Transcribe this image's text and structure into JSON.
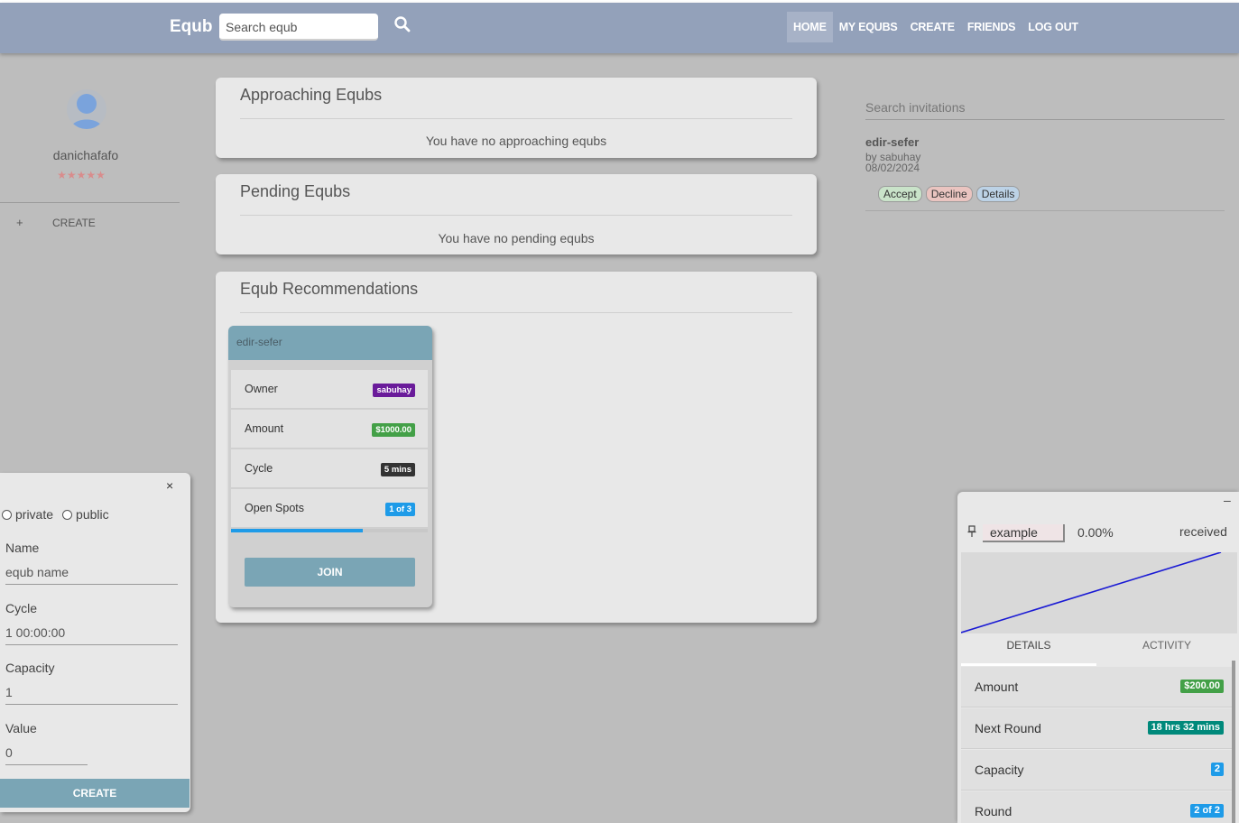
{
  "nav": {
    "brand": "Equb",
    "search_placeholder": "Search equb",
    "links": [
      "HOME",
      "MY EQUBS",
      "CREATE",
      "FRIENDS",
      "LOG OUT"
    ],
    "active": "HOME"
  },
  "sidebar": {
    "username": "danichafafo",
    "stars": "★★★★★",
    "create_label": "CREATE",
    "plus": "+"
  },
  "approaching": {
    "title": "Approaching Equbs",
    "empty": "You have no approaching equbs"
  },
  "pending": {
    "title": "Pending Equbs",
    "empty": "You have no pending equbs"
  },
  "recommendations": {
    "title": "Equb Recommendations",
    "card": {
      "name": "edir-sefer",
      "rows": [
        {
          "label": "Owner",
          "value": "sabuhay",
          "color": "#6a1b9a"
        },
        {
          "label": "Amount",
          "value": "$1000.00",
          "color": "#43a047"
        },
        {
          "label": "Cycle",
          "value": "5 mins",
          "color": "#333333"
        },
        {
          "label": "Open Spots",
          "value": "1 of 3",
          "color": "#1e9be8"
        }
      ],
      "progress_fraction": 0.67,
      "join_label": "JOIN"
    }
  },
  "invitations": {
    "search_placeholder": "Search invitations",
    "items": [
      {
        "name": "edir-sefer",
        "by": "by sabuhay",
        "date": "08/02/2024",
        "accept": "Accept",
        "decline": "Decline",
        "details": "Details"
      }
    ]
  },
  "create_form": {
    "close": "×",
    "radio_private": "private",
    "radio_public": "public",
    "fields": [
      {
        "label": "Name",
        "value": "equb name"
      },
      {
        "label": "Cycle",
        "value": "1 00:00:00"
      },
      {
        "label": "Capacity",
        "value": "1"
      },
      {
        "label": "Value",
        "value": "0"
      }
    ],
    "submit": "CREATE"
  },
  "detail_panel": {
    "minimize": "–",
    "pin": "📌",
    "example_value": "example",
    "percent": "0.00%",
    "received_label": "received",
    "tabs": [
      "DETAILS",
      "ACTIVITY"
    ],
    "rows": [
      {
        "label": "Amount",
        "value": "$200.00",
        "color": "#43a047"
      },
      {
        "label": "Next Round",
        "value": "18 hrs 32 mins",
        "color": "#00897b"
      },
      {
        "label": "Capacity",
        "value": "2",
        "color": "#1e9be8"
      },
      {
        "label": "Round",
        "value": "2 of 2",
        "color": "#1e9be8"
      }
    ],
    "line_color": "#1a1ad4"
  },
  "colors": {
    "navbar": "#93a1ba",
    "accent": "#7aa5b5",
    "background": "#bdbdbd"
  }
}
